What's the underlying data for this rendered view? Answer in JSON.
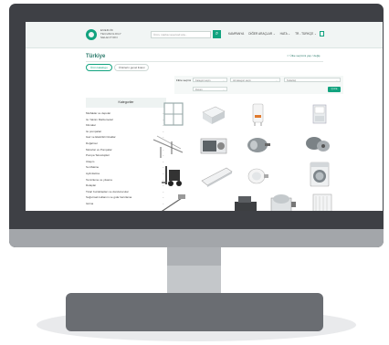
{
  "brand": {
    "name_line1": "ENERJİK",
    "name_line2": "TECHNOLOGY",
    "name_line3": "SELECTION",
    "accent": "#12a37f"
  },
  "nav": {
    "search_placeholder": "Ürün, marka veya kod ara...",
    "links": [
      "KAMPANYA",
      "DİĞER ARAÇLAR ⌄",
      "HATA ⌄",
      "TR - TÜRKÇE ⌄"
    ]
  },
  "page": {
    "title": "Türkiye",
    "right_link": "☆ Ülke seçimini yap / değiş",
    "tabs": [
      "Ürün katalogu",
      "Ürünlerin genel listesi"
    ]
  },
  "sidebar": {
    "heading": "Kategoriler",
    "items": [
      "Mutfaklar ve depolar",
      "Isı Yalıtım Malzemeleri",
      "Klimalar",
      "Isı pompaları",
      "Gaz ve Elektrikli Ocaklar",
      "Doğalmur",
      "Motorlar ve Pompalar",
      "Pompa Teknolojileri",
      "Ulaşım",
      "Su Makine",
      "Aydınlatma",
      "Temizleme ve yıkama",
      "Dolaplar",
      "Ticari buzdolapları ve dondurucular",
      "Soğutmalı kullanım ve gıda hazırlama",
      "Isıtma"
    ]
  },
  "filter": {
    "label": "Filtre seçimi",
    "select1": "Kategori seçin",
    "select2": "Alt kategori seçin",
    "select3": "Tedarikçi",
    "select4": "Durum",
    "apply": "Q Ara"
  },
  "products": [
    "window-product",
    "insulation-box-product",
    "boiler-product",
    "heat-pump-product",
    "cable-tray-product",
    "ac-outdoor-unit-product",
    "motor-product",
    "gear-motor-product",
    "forklift-product",
    "ac-indoor-unit-product",
    "led-lamp-product",
    "washing-machine-product",
    "street-lamp-product",
    "sewing-machine-product",
    "radiator-product",
    "fridge-product"
  ]
}
